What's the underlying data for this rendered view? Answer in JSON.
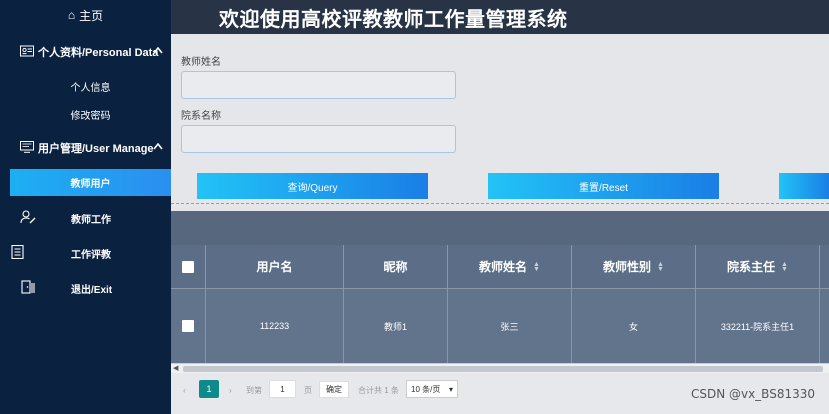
{
  "header": {
    "title": "欢迎使用高校评教教师工作量管理系统"
  },
  "sidebar": {
    "home": "主页",
    "groups": [
      {
        "label": "个人资料/Personal Data",
        "items": [
          "个人信息",
          "修改密码"
        ]
      },
      {
        "label": "用户管理/User Manage",
        "items": [
          "教师用户"
        ]
      }
    ],
    "items": [
      "教师工作",
      "工作评教",
      "退出/Exit"
    ]
  },
  "form": {
    "teacher_name_label": "教师姓名",
    "teacher_name_value": "",
    "dept_name_label": "院系名称",
    "dept_name_value": "",
    "query_button": "查询/Query",
    "reset_button": "重置/Reset"
  },
  "table": {
    "columns": [
      "用户名",
      "昵称",
      "教师姓名",
      "教师性别",
      "院系主任"
    ],
    "rows": [
      [
        "112233",
        "教师1",
        "张三",
        "女",
        "332211-院系主任1"
      ]
    ]
  },
  "pager": {
    "current_page": "1",
    "goto_label": "到第",
    "goto_value": "1",
    "page_unit": "页",
    "confirm": "确定",
    "total": "合计共 1 条",
    "page_size": "10 条/页"
  },
  "watermark": "CSDN @vx_BS81330",
  "colors": {
    "sidebar": "#0b2140",
    "accent": "#1daff2",
    "header": "#283446",
    "table": "#5b6d87",
    "pager_active": "#0f8a8a"
  }
}
